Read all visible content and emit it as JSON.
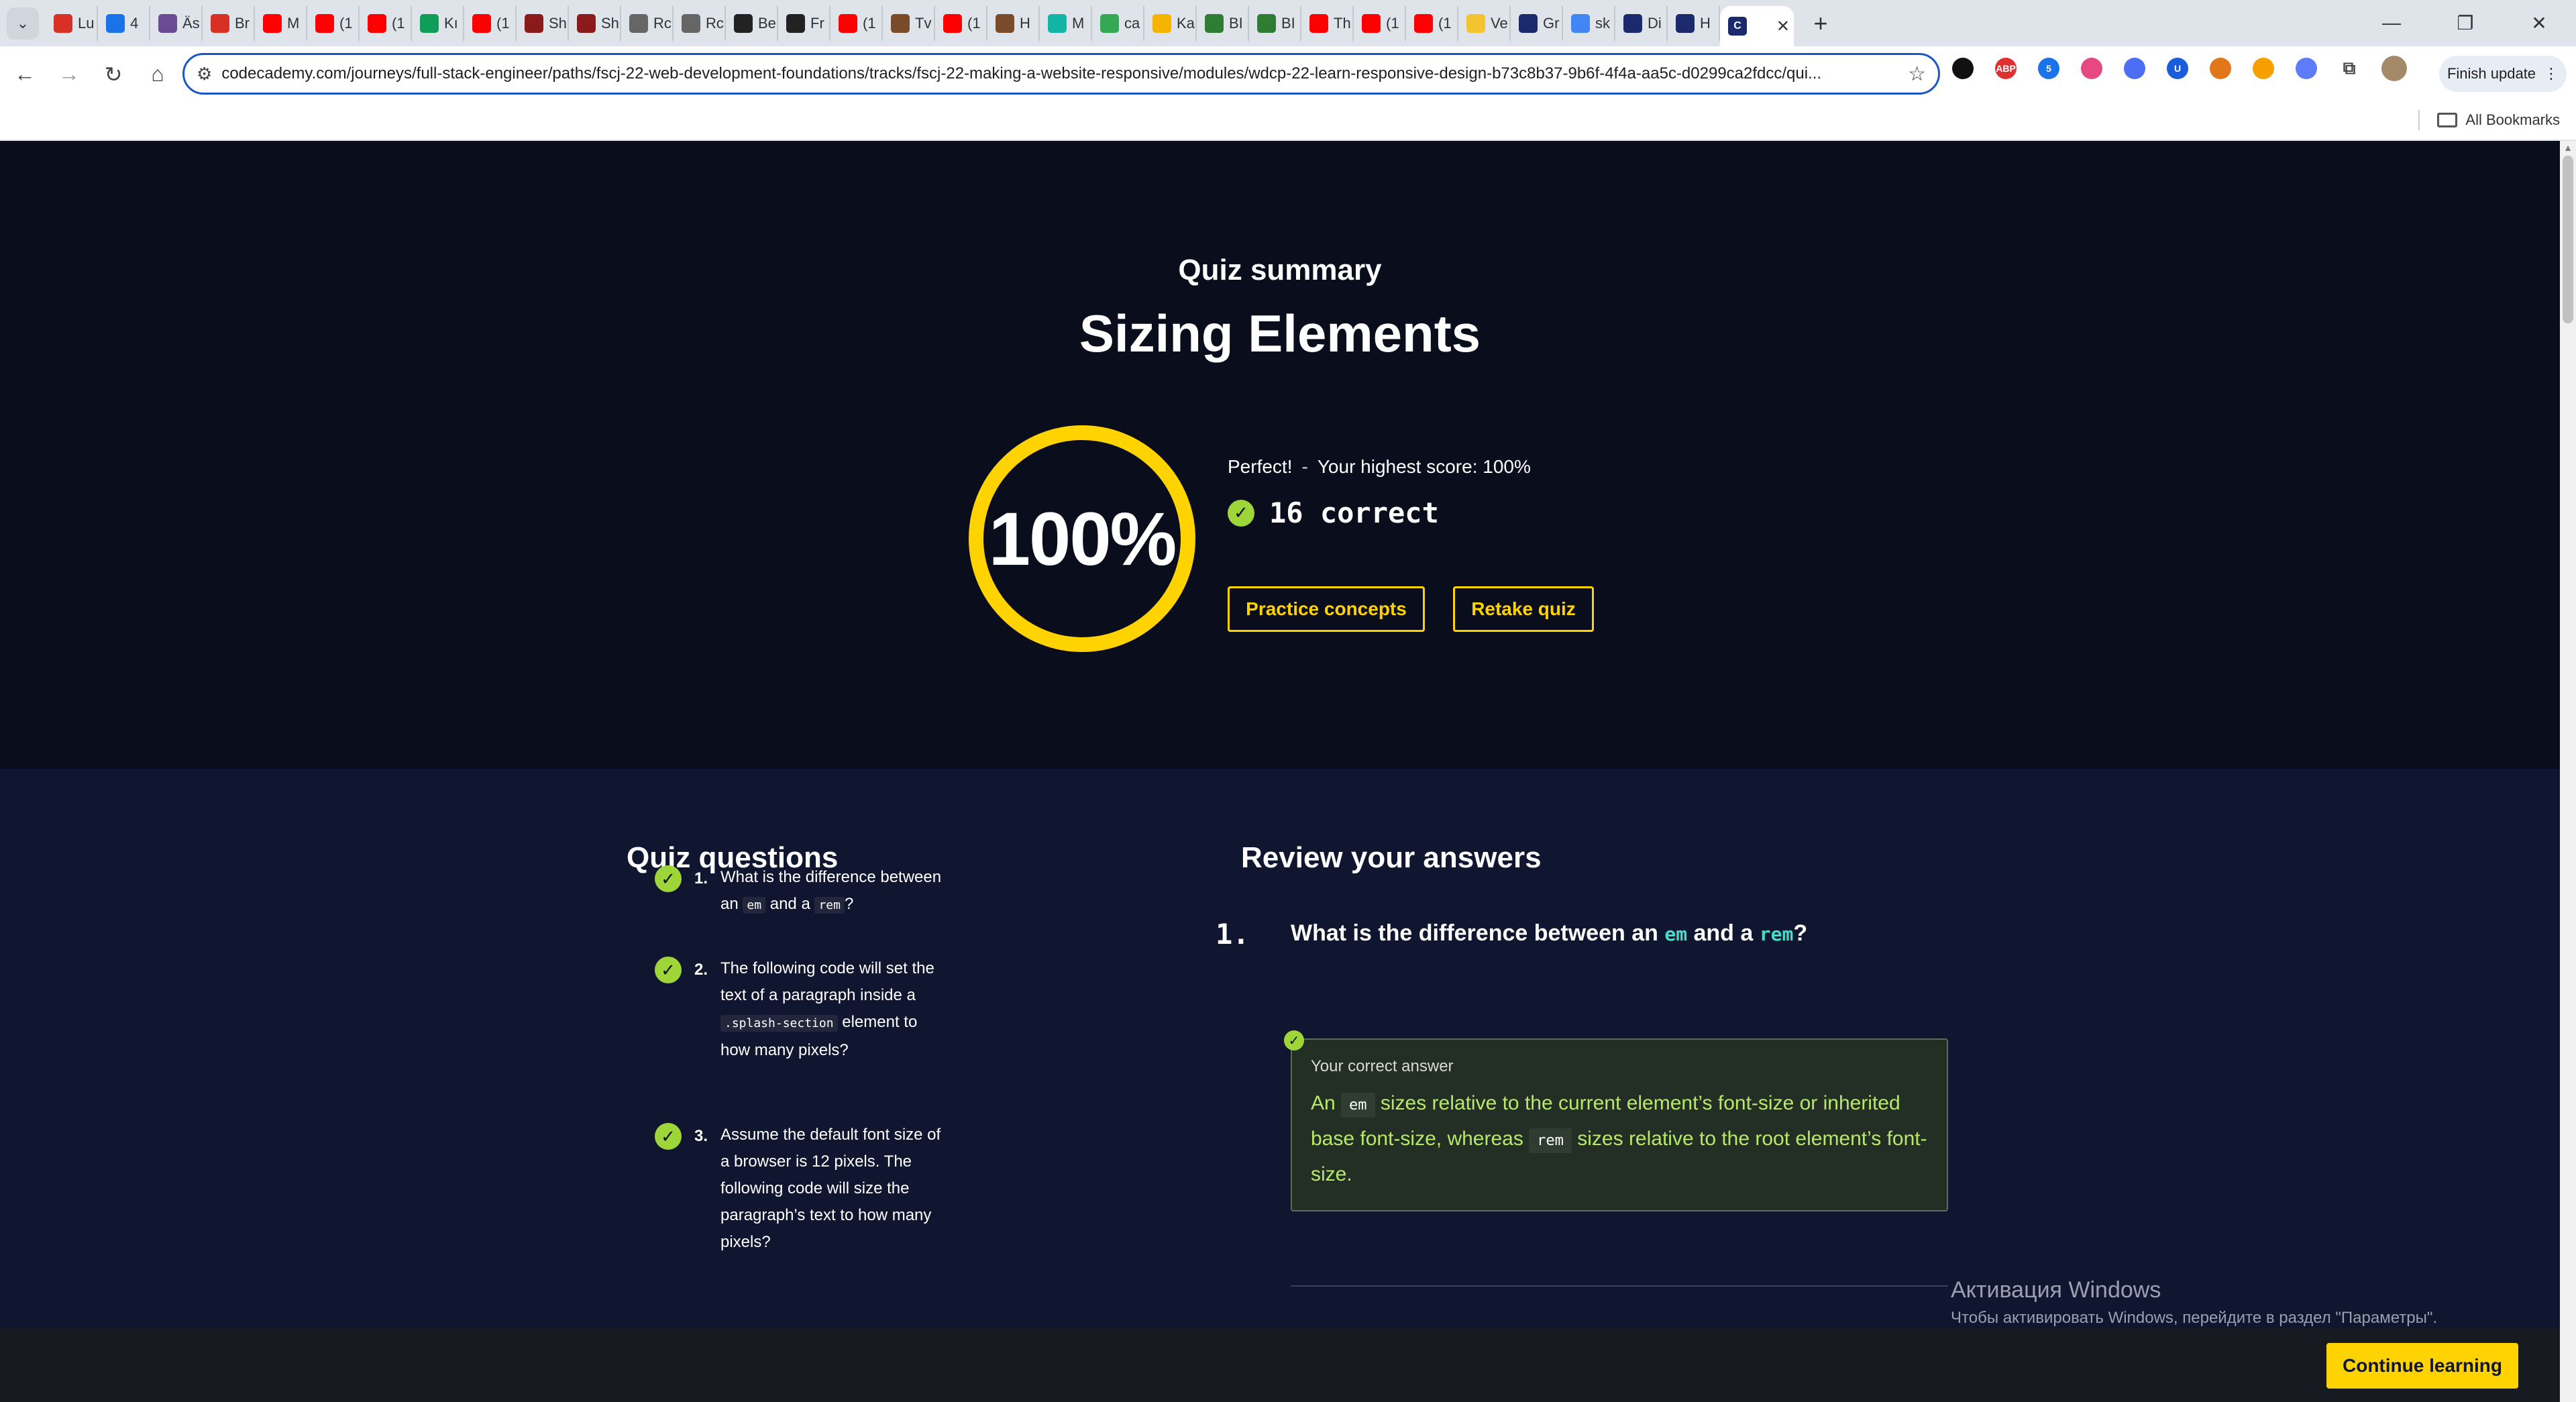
{
  "browser": {
    "tabs": [
      {
        "label": "Lu",
        "icon": "gmail-icon",
        "color": "#d93025"
      },
      {
        "label": "4",
        "icon": "app-icon",
        "color": "#1a73e8"
      },
      {
        "label": "Äs",
        "icon": "circle-icon",
        "color": "#6a4c93"
      },
      {
        "label": "Br",
        "icon": "gmail-icon",
        "color": "#d93025"
      },
      {
        "label": "M",
        "icon": "youtube-icon",
        "color": "#ff0000"
      },
      {
        "label": "(1",
        "icon": "youtube-icon",
        "color": "#ff0000"
      },
      {
        "label": "(1",
        "icon": "youtube-icon",
        "color": "#ff0000"
      },
      {
        "label": "Kı",
        "icon": "sheets-plus-icon",
        "color": "#0f9d58"
      },
      {
        "label": "(1",
        "icon": "youtube-icon",
        "color": "#ff0000"
      },
      {
        "label": "Sh",
        "icon": "sv-icon",
        "color": "#8b1a1a"
      },
      {
        "label": "Sh",
        "icon": "sv-icon",
        "color": "#8b1a1a"
      },
      {
        "label": "Rc",
        "icon": "ys-icon",
        "color": "#666666"
      },
      {
        "label": "Rc",
        "icon": "ys-icon",
        "color": "#666666"
      },
      {
        "label": "Be",
        "icon": "c-icon",
        "color": "#222222"
      },
      {
        "label": "Fr",
        "icon": "amazon-icon",
        "color": "#222222"
      },
      {
        "label": "(1",
        "icon": "youtube-icon",
        "color": "#ff0000"
      },
      {
        "label": "Tv",
        "icon": "bug-icon",
        "color": "#7a4b2a"
      },
      {
        "label": "(1",
        "icon": "youtube-icon",
        "color": "#ff0000"
      },
      {
        "label": "H",
        "icon": "bug-icon",
        "color": "#7a4b2a"
      },
      {
        "label": "M",
        "icon": "mind-icon",
        "color": "#12b5a5"
      },
      {
        "label": "ca",
        "icon": "drive-icon",
        "color": "#34a853"
      },
      {
        "label": "Ka",
        "icon": "keep-icon",
        "color": "#f4b400"
      },
      {
        "label": "BI",
        "icon": "bbb-icon",
        "color": "#2e7d32"
      },
      {
        "label": "BI",
        "icon": "bbb-icon",
        "color": "#2e7d32"
      },
      {
        "label": "Th",
        "icon": "youtube-icon",
        "color": "#ff0000"
      },
      {
        "label": "(1",
        "icon": "youtube-icon",
        "color": "#ff0000"
      },
      {
        "label": "(1",
        "icon": "youtube-icon",
        "color": "#ff0000"
      },
      {
        "label": "Ve",
        "icon": "note-icon",
        "color": "#f4c430"
      },
      {
        "label": "Gr",
        "icon": "codecademy-icon",
        "color": "#1a2a6c"
      },
      {
        "label": "sk",
        "icon": "google-icon",
        "color": "#4285f4"
      },
      {
        "label": "Di",
        "icon": "codecademy-icon",
        "color": "#1a2a6c"
      },
      {
        "label": "H",
        "icon": "codecademy-icon",
        "color": "#1a2a6c"
      }
    ],
    "active_tab": {
      "label": "",
      "icon": "codecademy-icon"
    },
    "url": "codecademy.com/journeys/full-stack-engineer/paths/fscj-22-web-development-foundations/tracks/fscj-22-making-a-website-responsive/modules/wdcp-22-learn-responsive-design-b73c8b37-9b6f-4f4a-aa5c-d0299ca2fdcc/qui...",
    "finish_update_label": "Finish update",
    "all_bookmarks_label": "All Bookmarks",
    "extensions": [
      {
        "name": "circle-ext-icon",
        "color": "#111111",
        "text": ""
      },
      {
        "name": "abp-icon",
        "color": "#e03131",
        "text": "ABP"
      },
      {
        "name": "ext-badge-icon",
        "color": "#1a73e8",
        "text": "5"
      },
      {
        "name": "target-ext-icon",
        "color": "#e64980",
        "text": ""
      },
      {
        "name": "bubbles-ext-icon",
        "color": "#4c6ef5",
        "text": ""
      },
      {
        "name": "bitwarden-icon",
        "color": "#175ddc",
        "text": "U"
      },
      {
        "name": "metamask-icon",
        "color": "#e2761b",
        "text": ""
      },
      {
        "name": "key-ext-icon",
        "color": "#f59f00",
        "text": ""
      },
      {
        "name": "gear-ext-icon",
        "color": "#5c7cfa",
        "text": ""
      }
    ]
  },
  "summary": {
    "subtitle": "Quiz summary",
    "title": "Sizing Elements",
    "score_percent": "100%",
    "score_value": 100,
    "perfect_label": "Perfect!",
    "separator": "-",
    "highest_score": "Your highest score: 100%",
    "correct_label": "16 correct",
    "practice_label": "Practice concepts",
    "retake_label": "Retake quiz"
  },
  "questions": {
    "heading": "Quiz questions",
    "items": [
      {
        "num": "1.",
        "parts": [
          "What is the difference between an ",
          "em",
          " and a ",
          "rem",
          "?"
        ]
      },
      {
        "num": "2.",
        "parts": [
          "The following code will set the text of a paragraph inside a ",
          ".splash-section",
          " element to how many pixels?"
        ]
      },
      {
        "num": "3.",
        "parts": [
          "Assume the default font size of a browser is 12 pixels. The following code will size the paragraph’s text to how many pixels?"
        ]
      }
    ]
  },
  "review": {
    "heading": "Review your answers",
    "q_num": "1.",
    "q_parts": [
      "What is the difference between an ",
      "em",
      " and a ",
      "rem",
      "?"
    ],
    "answer_label": "Your correct answer",
    "answer_parts": [
      "An ",
      "em",
      " sizes relative to the current element’s font-size or inherited base font-size, whereas ",
      "rem",
      " sizes relative to the root element’s font-size."
    ]
  },
  "windows_activation": {
    "line1": "Активация Windows",
    "line2": "Чтобы активировать Windows, перейдите в раздел \"Параметры\"."
  },
  "footer": {
    "continue_label": "Continue learning"
  },
  "colors": {
    "accent": "#ffd300",
    "correct": "#9ed63a",
    "code_accent": "#3fe0c5",
    "hero_bg": "#0a0d1c",
    "lower_bg": "#10162f"
  }
}
